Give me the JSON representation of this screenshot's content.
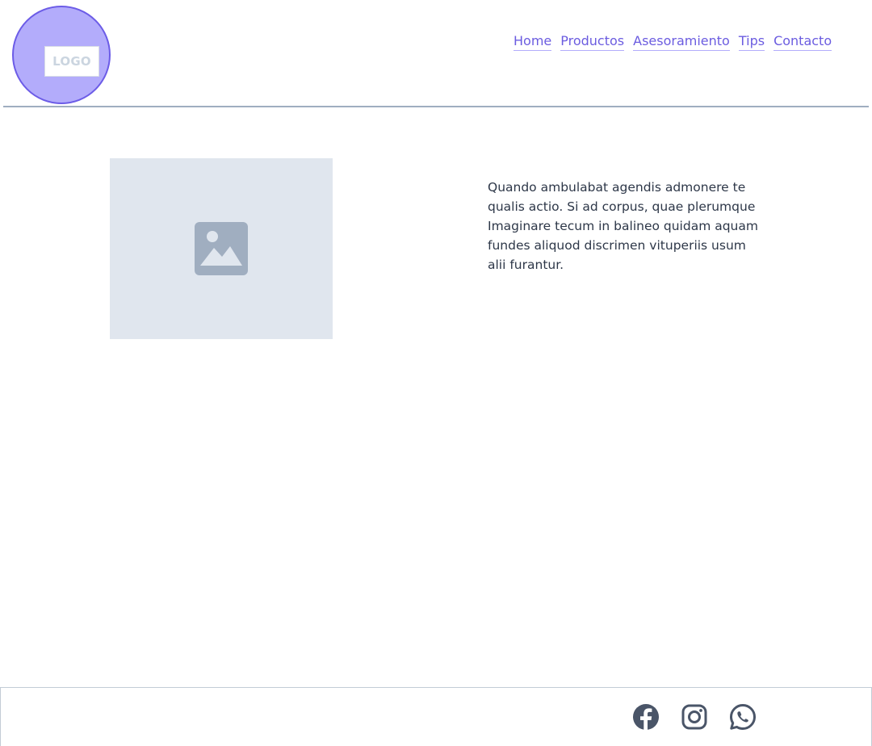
{
  "header": {
    "logo_text": "LOGO",
    "nav": [
      {
        "label": "Home"
      },
      {
        "label": "Productos"
      },
      {
        "label": "Asesoramiento"
      },
      {
        "label": "Tips"
      },
      {
        "label": "Contacto"
      }
    ]
  },
  "main": {
    "image_icon": "image-placeholder-icon",
    "paragraph": "Quando ambulabat agendis admonere te qualis actio. Si ad corpus, quae plerumque Imaginare tecum in balineo quidam aquam fundes aliquod discrimen vituperiis usum alii furantur."
  },
  "footer": {
    "social": [
      {
        "icon": "facebook-icon"
      },
      {
        "icon": "instagram-icon"
      },
      {
        "icon": "whatsapp-icon"
      }
    ]
  },
  "colors": {
    "accent": "#6c5ce7",
    "logo_fill": "#b3acfb",
    "text": "#2d3748",
    "icon": "#4a5568",
    "placeholder_bg": "#e0e6ee"
  }
}
